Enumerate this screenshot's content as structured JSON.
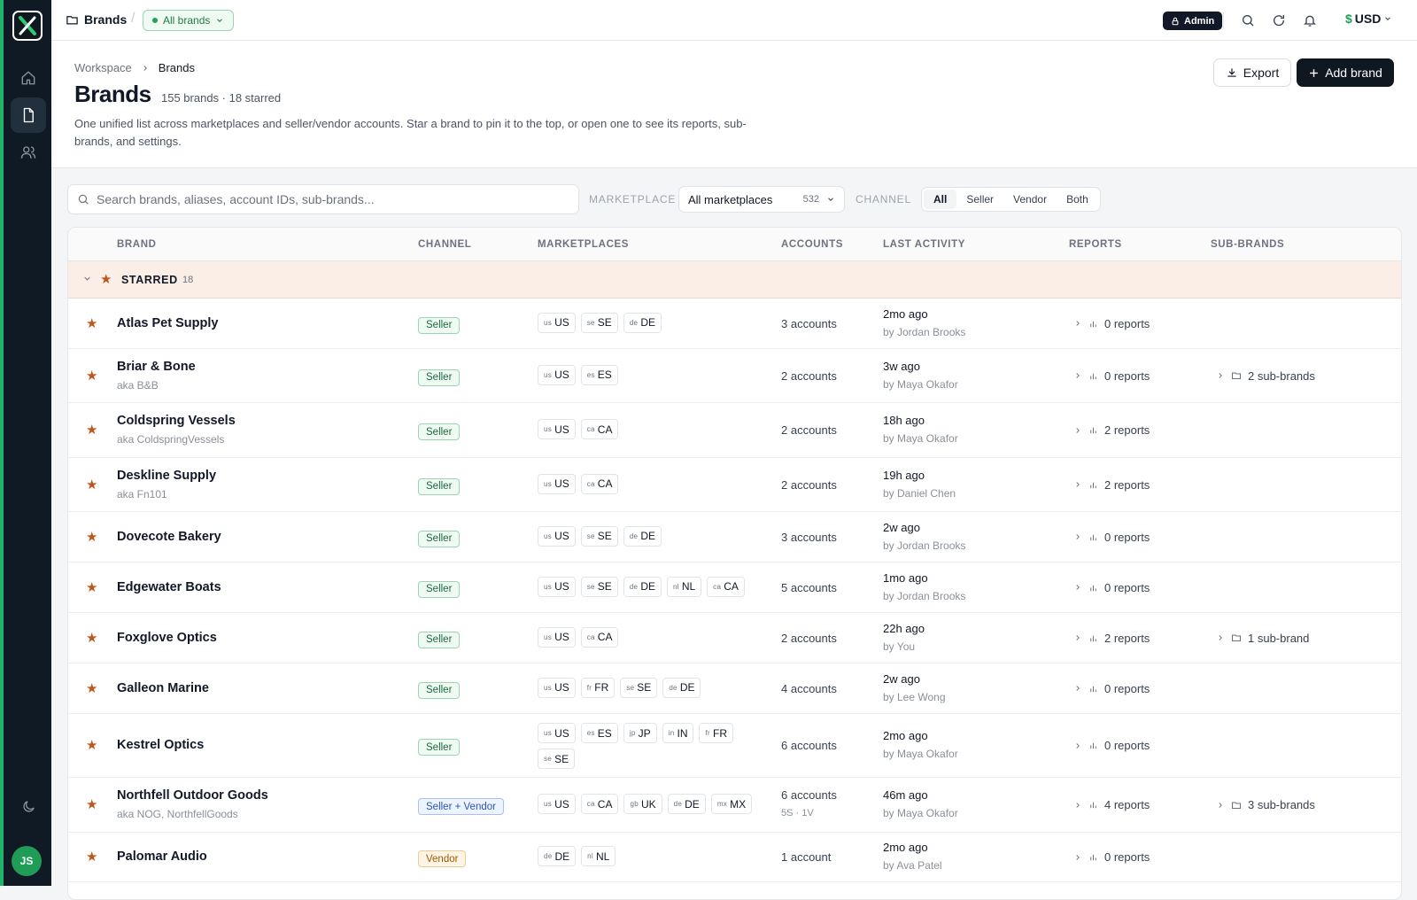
{
  "app": {
    "logo_letter": "X",
    "accent": "#1fb36a"
  },
  "sidebar": {
    "items": [
      {
        "name": "home-icon"
      },
      {
        "name": "document-icon",
        "active": true
      },
      {
        "name": "users-icon"
      }
    ],
    "theme_icon": "moon-icon",
    "avatar_initials": "JS"
  },
  "topbar": {
    "section_title": "Brands",
    "brand_filter_label": "All brands",
    "role_badge": "Admin",
    "currency_symbol": "$",
    "currency_code": "USD"
  },
  "header": {
    "breadcrumb": [
      "Workspace",
      "Brands"
    ],
    "title": "Brands",
    "counts": "155 brands · 18 starred",
    "description": "One unified list across marketplaces and seller/vendor accounts. Star a brand to pin it to the top, or open one to see its reports, sub-brands, and settings.",
    "export_label": "Export",
    "add_label": "Add brand"
  },
  "filters": {
    "search_placeholder": "Search brands, aliases, account IDs, sub-brands...",
    "marketplace_label": "MARKETPLACE",
    "marketplace_value": "All marketplaces",
    "marketplace_count": "532",
    "channel_label": "CHANNEL",
    "channel_options": [
      "All",
      "Seller",
      "Vendor",
      "Both"
    ],
    "channel_selected": "All"
  },
  "table": {
    "columns": [
      "BRAND",
      "CHANNEL",
      "MARKETPLACES",
      "ACCOUNTS",
      "LAST ACTIVITY",
      "REPORTS",
      "SUB-BRANDS"
    ],
    "group": {
      "label": "STARRED",
      "count": "18"
    },
    "rows": [
      {
        "name": "Atlas Pet Supply",
        "aka": "",
        "channel": "Seller",
        "markets": [
          [
            "us",
            "US"
          ],
          [
            "se",
            "SE"
          ],
          [
            "de",
            "DE"
          ]
        ],
        "accounts": "3 accounts",
        "accounts_sub": "",
        "activity": "2mo ago",
        "by": "by Jordan Brooks",
        "reports": "0 reports",
        "sub_brands": ""
      },
      {
        "name": "Briar & Bone",
        "aka": "aka B&B",
        "channel": "Seller",
        "markets": [
          [
            "us",
            "US"
          ],
          [
            "es",
            "ES"
          ]
        ],
        "accounts": "2 accounts",
        "accounts_sub": "",
        "activity": "3w ago",
        "by": "by Maya Okafor",
        "reports": "0 reports",
        "sub_brands": "2 sub-brands"
      },
      {
        "name": "Coldspring Vessels",
        "aka": "aka ColdspringVessels",
        "channel": "Seller",
        "markets": [
          [
            "us",
            "US"
          ],
          [
            "ca",
            "CA"
          ]
        ],
        "accounts": "2 accounts",
        "accounts_sub": "",
        "activity": "18h ago",
        "by": "by Maya Okafor",
        "reports": "2 reports",
        "sub_brands": ""
      },
      {
        "name": "Deskline Supply",
        "aka": "aka Fn101",
        "channel": "Seller",
        "markets": [
          [
            "us",
            "US"
          ],
          [
            "ca",
            "CA"
          ]
        ],
        "accounts": "2 accounts",
        "accounts_sub": "",
        "activity": "19h ago",
        "by": "by Daniel Chen",
        "reports": "2 reports",
        "sub_brands": ""
      },
      {
        "name": "Dovecote Bakery",
        "aka": "",
        "channel": "Seller",
        "markets": [
          [
            "us",
            "US"
          ],
          [
            "se",
            "SE"
          ],
          [
            "de",
            "DE"
          ]
        ],
        "accounts": "3 accounts",
        "accounts_sub": "",
        "activity": "2w ago",
        "by": "by Jordan Brooks",
        "reports": "0 reports",
        "sub_brands": ""
      },
      {
        "name": "Edgewater Boats",
        "aka": "",
        "channel": "Seller",
        "markets": [
          [
            "us",
            "US"
          ],
          [
            "se",
            "SE"
          ],
          [
            "de",
            "DE"
          ],
          [
            "nl",
            "NL"
          ],
          [
            "ca",
            "CA"
          ]
        ],
        "accounts": "5 accounts",
        "accounts_sub": "",
        "activity": "1mo ago",
        "by": "by Jordan Brooks",
        "reports": "0 reports",
        "sub_brands": ""
      },
      {
        "name": "Foxglove Optics",
        "aka": "",
        "channel": "Seller",
        "markets": [
          [
            "us",
            "US"
          ],
          [
            "ca",
            "CA"
          ]
        ],
        "accounts": "2 accounts",
        "accounts_sub": "",
        "activity": "22h ago",
        "by": "by You",
        "reports": "2 reports",
        "sub_brands": "1 sub-brand"
      },
      {
        "name": "Galleon Marine",
        "aka": "",
        "channel": "Seller",
        "markets": [
          [
            "us",
            "US"
          ],
          [
            "fr",
            "FR"
          ],
          [
            "se",
            "SE"
          ],
          [
            "de",
            "DE"
          ]
        ],
        "accounts": "4 accounts",
        "accounts_sub": "",
        "activity": "2w ago",
        "by": "by Lee Wong",
        "reports": "0 reports",
        "sub_brands": ""
      },
      {
        "name": "Kestrel Optics",
        "aka": "",
        "channel": "Seller",
        "markets": [
          [
            "us",
            "US"
          ],
          [
            "es",
            "ES"
          ],
          [
            "jp",
            "JP"
          ],
          [
            "in",
            "IN"
          ],
          [
            "fr",
            "FR"
          ],
          [
            "se",
            "SE"
          ]
        ],
        "accounts": "6 accounts",
        "accounts_sub": "",
        "activity": "2mo ago",
        "by": "by Maya Okafor",
        "reports": "0 reports",
        "sub_brands": ""
      },
      {
        "name": "Northfell Outdoor Goods",
        "aka": "aka NOG, NorthfellGoods",
        "channel": "Seller + Vendor",
        "markets": [
          [
            "us",
            "US"
          ],
          [
            "ca",
            "CA"
          ],
          [
            "gb",
            "UK"
          ],
          [
            "de",
            "DE"
          ],
          [
            "mx",
            "MX"
          ]
        ],
        "accounts": "6 accounts",
        "accounts_sub": "5S · 1V",
        "activity": "46m ago",
        "by": "by Maya Okafor",
        "reports": "4 reports",
        "sub_brands": "3 sub-brands"
      },
      {
        "name": "Palomar Audio",
        "aka": "",
        "channel": "Vendor",
        "markets": [
          [
            "de",
            "DE"
          ],
          [
            "nl",
            "NL"
          ]
        ],
        "accounts": "1 account",
        "accounts_sub": "",
        "activity": "2mo ago",
        "by": "by Ava Patel",
        "reports": "0 reports",
        "sub_brands": ""
      }
    ]
  }
}
